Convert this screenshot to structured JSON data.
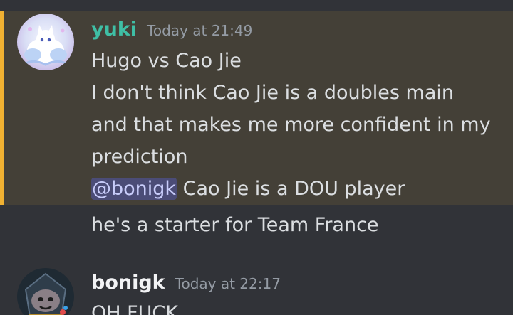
{
  "colors": {
    "background": "#313338",
    "highlight_bg": "#444037",
    "highlight_border": "#f0b132",
    "yuki_name": "#3fbfa5",
    "bonigk_name": "#f2f3f5",
    "text": "#dbdee1",
    "timestamp": "#949ba4",
    "mention_bg": "#4a4f86",
    "mention_text": "#c9cdfb"
  },
  "messages": [
    {
      "username": "yuki",
      "timestamp": "Today at 21:49",
      "avatar_icon": "white-fox-avatar",
      "highlighted": true,
      "lines": [
        "Hugo vs Cao Jie",
        "I don't think Cao Jie is a doubles main",
        "and that makes me more confident in my",
        "prediction"
      ],
      "mention": "@bonigk",
      "mention_line_rest": " Cao Jie is a DOU player",
      "followup": "he's a starter for Team France"
    },
    {
      "username": "bonigk",
      "timestamp": "Today at 22:17",
      "avatar_icon": "character-avatar",
      "first_line": "OH FUCK"
    }
  ]
}
